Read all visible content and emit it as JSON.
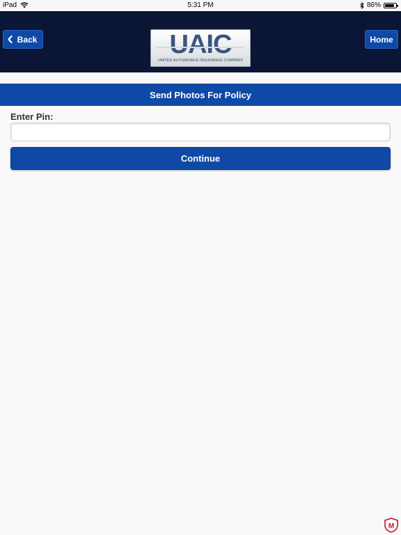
{
  "status_bar": {
    "device": "iPad",
    "time": "5:31 PM",
    "battery_text": "86%",
    "battery_level": 0.86,
    "icons": [
      "wifi-icon",
      "bluetooth-icon",
      "battery-icon"
    ]
  },
  "header": {
    "back_label": "Back",
    "home_label": "Home",
    "logo_text": "UAIC",
    "logo_subtitle": "UNITED AUTOMOBILE INSURANCE COMPANY",
    "back_icon": "chevron-left-icon"
  },
  "page": {
    "title": "Send Photos For Policy"
  },
  "form": {
    "pin_label": "Enter Pin:",
    "pin_value": "",
    "pin_placeholder": "",
    "continue_label": "Continue"
  },
  "badge": {
    "icon": "security-shield-icon",
    "letter": "M"
  },
  "colors": {
    "header_bg": "#0b1535",
    "accent": "#0e49a6",
    "page_bg": "#f9f9f9",
    "badge_red": "#c8102e"
  }
}
